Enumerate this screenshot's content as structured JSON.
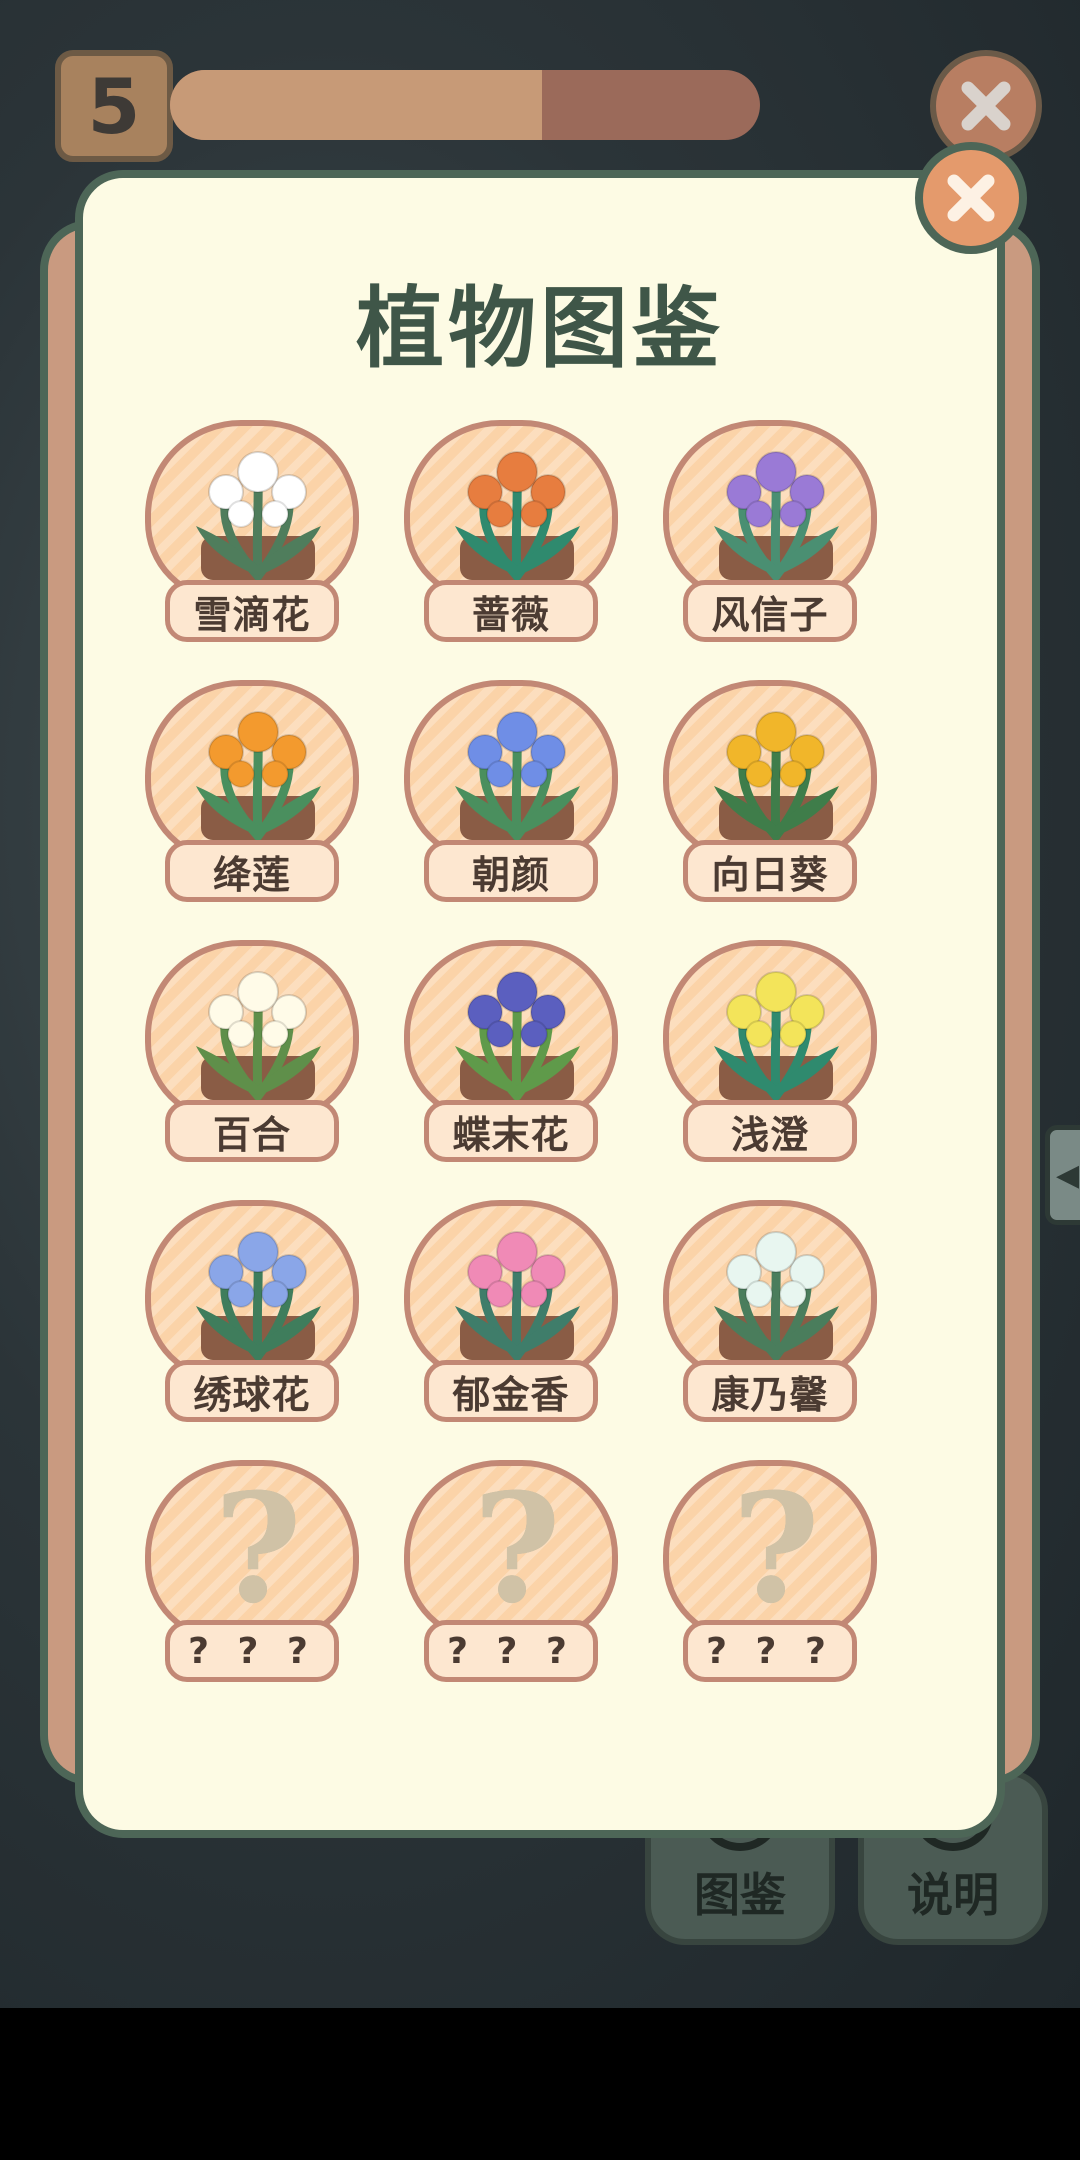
{
  "hud": {
    "level": "5",
    "progress": 0.63
  },
  "dialog": {
    "title": "植物图鉴"
  },
  "plants": [
    {
      "name": "雪滴花",
      "color": "#ffffff",
      "accent": "#4f7d5c"
    },
    {
      "name": "蔷薇",
      "color": "#e77d3f",
      "accent": "#2f8a6e"
    },
    {
      "name": "风信子",
      "color": "#9a7ad6",
      "accent": "#4a8f72"
    },
    {
      "name": "绛莲",
      "color": "#f39a2e",
      "accent": "#4a8f5e"
    },
    {
      "name": "朝颜",
      "color": "#6f8ee6",
      "accent": "#4a8f5e"
    },
    {
      "name": "向日葵",
      "color": "#f1b62a",
      "accent": "#3f7d4a"
    },
    {
      "name": "百合",
      "color": "#fffbe8",
      "accent": "#5f8f4a"
    },
    {
      "name": "蝶末花",
      "color": "#5b5fbf",
      "accent": "#5f9a4a"
    },
    {
      "name": "浅澄",
      "color": "#f3e45a",
      "accent": "#2f8a6e"
    },
    {
      "name": "绣球花",
      "color": "#8aa6e8",
      "accent": "#3f7d5c"
    },
    {
      "name": "郁金香",
      "color": "#f08ab6",
      "accent": "#3f7d6a"
    },
    {
      "name": "康乃馨",
      "color": "#e8f6f0",
      "accent": "#4a7d5c"
    }
  ],
  "locked": [
    {
      "name": "? ? ?"
    },
    {
      "name": "? ? ?"
    },
    {
      "name": "? ? ?"
    }
  ],
  "bg_buttons": {
    "codex": "图鉴",
    "help": "说明"
  }
}
